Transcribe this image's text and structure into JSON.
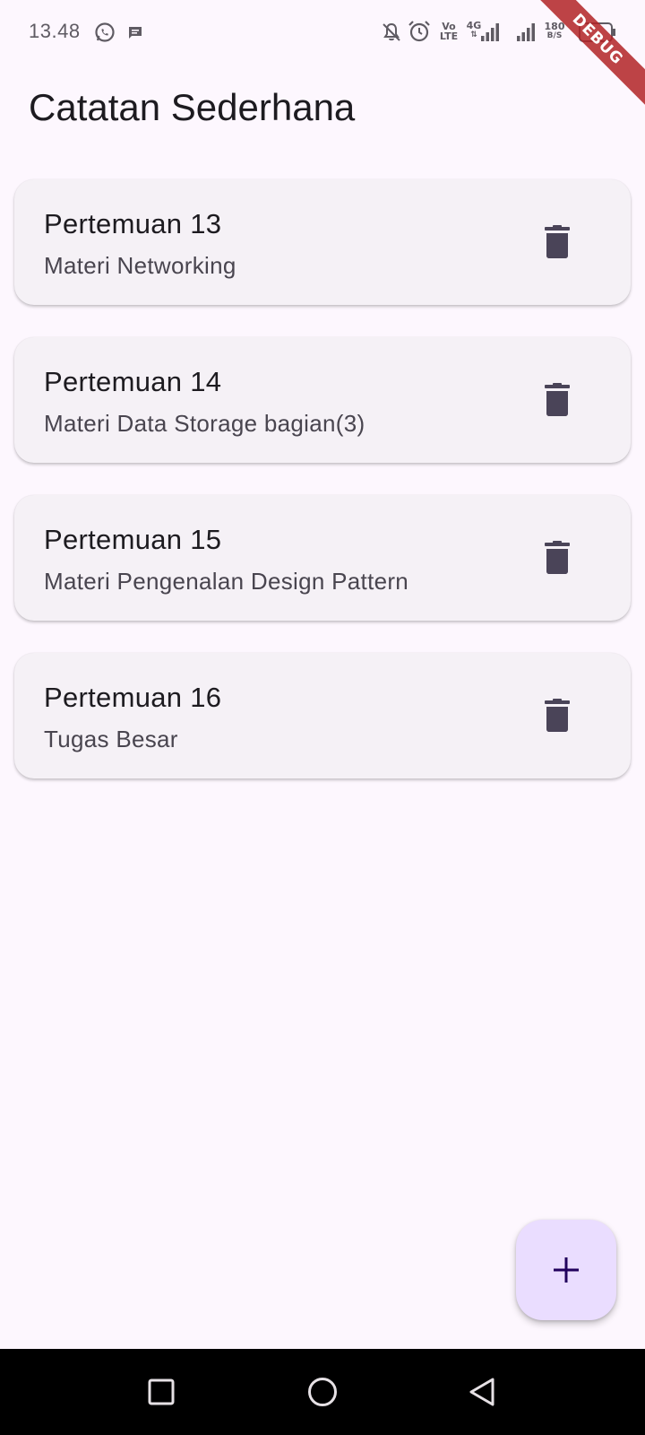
{
  "status_bar": {
    "time": "13.48",
    "network_top": "Vo",
    "network_bottom": "LTE",
    "cell_type": "4G",
    "speed_value": "180",
    "speed_unit": "B/S",
    "icons": [
      "whatsapp-icon",
      "message-icon",
      "notifications-off-icon",
      "alarm-icon",
      "volte-icon",
      "signal-4g-icon",
      "signal-icon",
      "data-speed-icon",
      "battery-icon"
    ]
  },
  "debug_banner": "DEBUG",
  "app_bar": {
    "title": "Catatan Sederhana"
  },
  "notes": [
    {
      "title": "Pertemuan 13",
      "subtitle": "Materi Networking"
    },
    {
      "title": "Pertemuan 14",
      "subtitle": "Materi Data Storage bagian(3)"
    },
    {
      "title": "Pertemuan 15",
      "subtitle": "Materi Pengenalan Design Pattern"
    },
    {
      "title": "Pertemuan 16",
      "subtitle": "Tugas Besar"
    }
  ],
  "colors": {
    "background": "#fdf7fe",
    "card": "#f5f1f6",
    "fab": "#eaddff",
    "fab_icon": "#21005d",
    "delete_icon": "#4a4458",
    "debug_banner": "#b22326"
  },
  "fab": {
    "icon": "plus-icon"
  },
  "nav_bar": {
    "icons": [
      "recents-square-icon",
      "home-circle-icon",
      "back-triangle-icon"
    ]
  }
}
